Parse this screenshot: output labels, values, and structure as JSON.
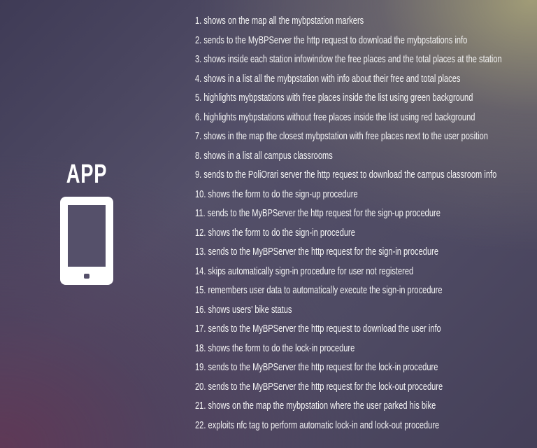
{
  "app_label": "APP",
  "icon": "smartphone-icon",
  "features": [
    "1. shows on the map all the mybpstation markers",
    "2. sends to the MyBPServer the http request to download the mybpstations info",
    "3. shows inside each station infowindow the free places and the total places at the station",
    "4.  shows in a list all the mybpstation with info about their free and total places",
    "5.  highlights mybpstations with free places inside the list using green background",
    "6. highlights mybpstations without free places inside the list using red background",
    "7. shows in the map the closest mybpstation with free places next to the user position",
    "8.  shows in a list all campus classrooms",
    "9. sends to the PoliOrari server the http request to download the campus classroom info",
    "10. shows the form to do the sign-up procedure",
    "11.  sends to the MyBPServer the http request for the sign-up procedure",
    "12.  shows the form to do the sign-in procedure",
    "13. sends to the MyBPServer the http request for the sign-in procedure",
    "14. skips automatically sign-in procedure for user not registered",
    "15. remembers user data to automatically execute the sign-in procedure",
    "16. shows users' bike status",
    "17. sends to the MyBPServer the http request to download the user info",
    "18. shows the form to do the lock-in procedure",
    "19. sends to the MyBPServer the http request for the lock-in procedure",
    "20. sends to the MyBPServer the http request for the lock-out procedure",
    "21. shows on the map the mybpstation where the user parked his bike",
    "22. exploits nfc tag to perform automatic lock-in and lock-out procedure"
  ]
}
